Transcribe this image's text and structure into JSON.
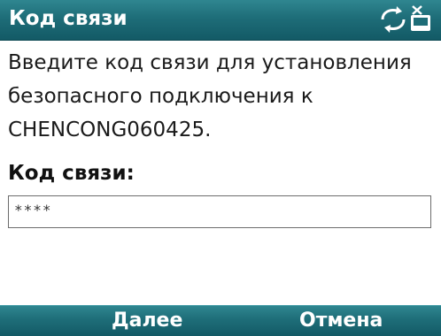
{
  "header": {
    "title": "Код связи",
    "status_icon": "bluetooth-connection-icon"
  },
  "main": {
    "message_lines": [
      "Введите код связи для установления",
      "безопасного подключения к",
      "CHENCONG060425."
    ],
    "field_label": "Код связи:",
    "code_value": "****"
  },
  "softkeys": {
    "left_label": "Далее",
    "right_label": "Отмена"
  },
  "colors": {
    "bar_top": "#2f8690",
    "bar_bottom": "#135a66",
    "text": "#1a1a1a"
  }
}
